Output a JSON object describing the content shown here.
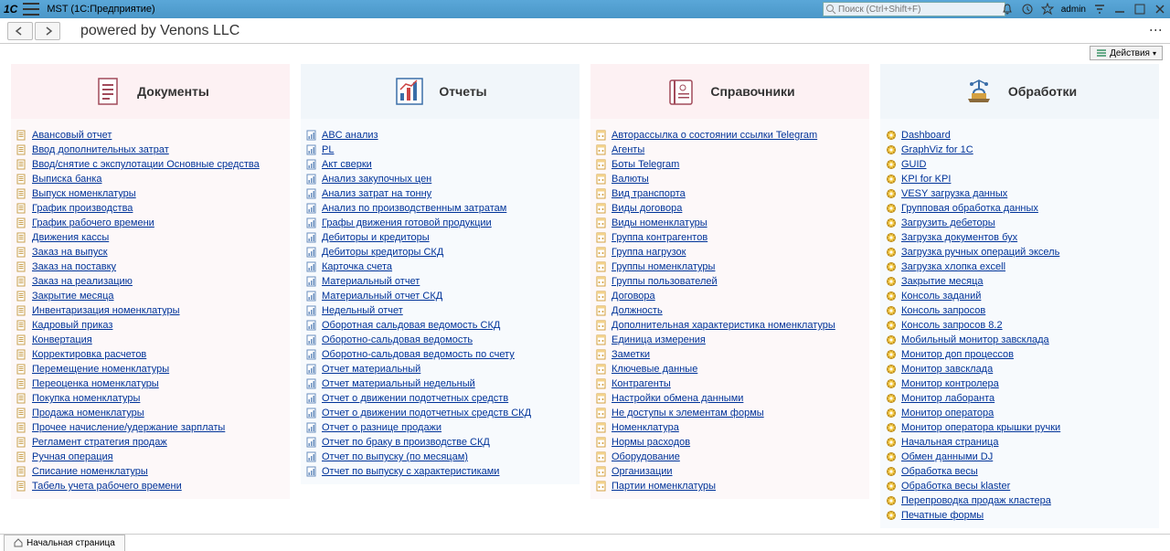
{
  "title_bar": {
    "logo_text": "1C",
    "app_title": "MST  (1С:Предприятие)",
    "search_placeholder": "Поиск (Ctrl+Shift+F)",
    "user": "admin"
  },
  "toolbar": {
    "brand": "powered by Venons LLC"
  },
  "actions": {
    "label": "Действия"
  },
  "cards": [
    {
      "title": "Документы",
      "icon": "doc",
      "color_class": "",
      "items": [
        {
          "label": "Авансовый отчет",
          "icon": "doc"
        },
        {
          "label": "Ввод дополнительных затрат",
          "icon": "doc"
        },
        {
          "label": "Ввод/снятие с экспулотации Основные средства",
          "icon": "doc"
        },
        {
          "label": "Выписка банка",
          "icon": "doc"
        },
        {
          "label": "Выпуск номенклатуры",
          "icon": "doc"
        },
        {
          "label": "График производства",
          "icon": "doc"
        },
        {
          "label": "График рабочего времени",
          "icon": "doc"
        },
        {
          "label": "Движения кассы",
          "icon": "doc"
        },
        {
          "label": "Заказ на выпуск",
          "icon": "doc"
        },
        {
          "label": "Заказ на поставку",
          "icon": "doc"
        },
        {
          "label": "Заказ на реализацию",
          "icon": "doc"
        },
        {
          "label": "Закрытие месяца",
          "icon": "doc"
        },
        {
          "label": "Инвентаризация номенклатуры",
          "icon": "doc"
        },
        {
          "label": "Кадровый приказ",
          "icon": "doc"
        },
        {
          "label": "Конвертация",
          "icon": "doc"
        },
        {
          "label": "Корректировка расчетов",
          "icon": "doc"
        },
        {
          "label": "Перемещение номенклатуры",
          "icon": "doc"
        },
        {
          "label": "Переоценка номенклатуры",
          "icon": "doc"
        },
        {
          "label": "Покупка номенклатуры",
          "icon": "doc"
        },
        {
          "label": "Продажа номенклатуры",
          "icon": "doc"
        },
        {
          "label": "Прочее начисление/удержание зарплаты",
          "icon": "doc"
        },
        {
          "label": "Регламент стратегия продаж",
          "icon": "doc"
        },
        {
          "label": "Ручная операция",
          "icon": "doc"
        },
        {
          "label": "Списание номенклатуры",
          "icon": "doc"
        },
        {
          "label": "Табель учета рабочего времени",
          "icon": "doc"
        }
      ]
    },
    {
      "title": "Отчеты",
      "icon": "chart",
      "color_class": "odd",
      "items": [
        {
          "label": "ABC анализ",
          "icon": "rep"
        },
        {
          "label": "PL",
          "icon": "rep"
        },
        {
          "label": "Акт сверки",
          "icon": "rep"
        },
        {
          "label": "Анализ закупочных цен",
          "icon": "rep"
        },
        {
          "label": "Анализ затрат на тонну",
          "icon": "rep"
        },
        {
          "label": "Анализ по производственным затратам",
          "icon": "rep"
        },
        {
          "label": "Графы движения готовой продукции",
          "icon": "rep"
        },
        {
          "label": "Дебиторы и кредиторы",
          "icon": "rep"
        },
        {
          "label": "Дебиторы кредиторы СКД",
          "icon": "rep"
        },
        {
          "label": "Карточка счета",
          "icon": "rep"
        },
        {
          "label": "Материальный отчет",
          "icon": "rep"
        },
        {
          "label": "Материальный отчет СКД",
          "icon": "rep"
        },
        {
          "label": "Недельный отчет",
          "icon": "rep"
        },
        {
          "label": "Оборотная сальдовая ведомость СКД",
          "icon": "rep"
        },
        {
          "label": "Оборотно-сальдовая ведомость",
          "icon": "rep"
        },
        {
          "label": "Оборотно-сальдовая ведомость по счету",
          "icon": "rep"
        },
        {
          "label": "Отчет материальный",
          "icon": "rep"
        },
        {
          "label": "Отчет материальный недельный",
          "icon": "rep"
        },
        {
          "label": "Отчет о движении подотчетных средств",
          "icon": "rep"
        },
        {
          "label": "Отчет о движении подотчетных средств СКД",
          "icon": "rep"
        },
        {
          "label": "Отчет о разнице продажи",
          "icon": "rep"
        },
        {
          "label": "Отчет по браку в производстве СКД",
          "icon": "rep"
        },
        {
          "label": "Отчет по выпуску (по месяцам)",
          "icon": "rep"
        },
        {
          "label": "Отчет по выпуску с характеристиками",
          "icon": "rep"
        }
      ]
    },
    {
      "title": "Справочники",
      "icon": "book",
      "color_class": "",
      "items": [
        {
          "label": "Авторассылка о состоянии ссылки Telegram",
          "icon": "ref"
        },
        {
          "label": "Агенты",
          "icon": "ref"
        },
        {
          "label": "Боты Telegram",
          "icon": "ref"
        },
        {
          "label": "Валюты",
          "icon": "ref"
        },
        {
          "label": "Вид транспорта",
          "icon": "ref"
        },
        {
          "label": "Виды договора",
          "icon": "ref"
        },
        {
          "label": "Виды номенклатуры",
          "icon": "ref"
        },
        {
          "label": "Группа контрагентов",
          "icon": "ref"
        },
        {
          "label": "Группа нагрузок",
          "icon": "ref"
        },
        {
          "label": "Группы номенклатуры",
          "icon": "ref"
        },
        {
          "label": "Группы пользователей",
          "icon": "ref"
        },
        {
          "label": "Договора",
          "icon": "ref"
        },
        {
          "label": "Должность",
          "icon": "ref"
        },
        {
          "label": "Дополнительная характеристика номенклатуры",
          "icon": "ref"
        },
        {
          "label": "Единица измерения",
          "icon": "ref"
        },
        {
          "label": "Заметки",
          "icon": "ref"
        },
        {
          "label": "Ключевые данные",
          "icon": "ref"
        },
        {
          "label": "Контрагенты",
          "icon": "ref"
        },
        {
          "label": "Настройки обмена данными",
          "icon": "ref"
        },
        {
          "label": "Не доступы к элементам формы",
          "icon": "ref"
        },
        {
          "label": "Номенклатура",
          "icon": "ref"
        },
        {
          "label": "Нормы расходов",
          "icon": "ref"
        },
        {
          "label": "Оборудование",
          "icon": "ref"
        },
        {
          "label": "Организации",
          "icon": "ref"
        },
        {
          "label": "Партии номенклатуры",
          "icon": "ref"
        }
      ]
    },
    {
      "title": "Обработки",
      "icon": "proc",
      "color_class": "odd",
      "items": [
        {
          "label": "Dashboard",
          "icon": "proc"
        },
        {
          "label": "GraphViz for 1C",
          "icon": "proc"
        },
        {
          "label": "GUID",
          "icon": "proc"
        },
        {
          "label": "KPI for KPI",
          "icon": "proc"
        },
        {
          "label": "VESY загрузка данных",
          "icon": "proc"
        },
        {
          "label": "Групповая обработка данных",
          "icon": "proc"
        },
        {
          "label": "Загрузить дебеторы",
          "icon": "proc"
        },
        {
          "label": "Загрузка документов бух",
          "icon": "proc"
        },
        {
          "label": "Загрузка ручных операций эксель",
          "icon": "proc"
        },
        {
          "label": "Загрузка хлопка excell",
          "icon": "proc"
        },
        {
          "label": "Закрытие месяца",
          "icon": "proc"
        },
        {
          "label": "Консоль заданий",
          "icon": "proc"
        },
        {
          "label": "Консоль запросов",
          "icon": "proc"
        },
        {
          "label": "Консоль запросов 8.2",
          "icon": "proc"
        },
        {
          "label": "Мобильный монитор завсклада",
          "icon": "proc"
        },
        {
          "label": "Монитор доп процессов",
          "icon": "proc"
        },
        {
          "label": "Монитор завсклада",
          "icon": "proc"
        },
        {
          "label": "Монитор контролера",
          "icon": "proc"
        },
        {
          "label": "Монитор лаборанта",
          "icon": "proc"
        },
        {
          "label": "Монитор оператора",
          "icon": "proc"
        },
        {
          "label": "Монитор оператора крышки ручки",
          "icon": "proc"
        },
        {
          "label": "Начальная страница",
          "icon": "proc"
        },
        {
          "label": "Обмен данными DJ",
          "icon": "proc"
        },
        {
          "label": "Обработка весы",
          "icon": "proc"
        },
        {
          "label": "Обработка весы klaster",
          "icon": "proc"
        },
        {
          "label": "Перепроводка продаж кластера",
          "icon": "proc"
        },
        {
          "label": "Печатные формы",
          "icon": "proc"
        }
      ]
    }
  ],
  "statusbar": {
    "tab": "Начальная страница"
  }
}
